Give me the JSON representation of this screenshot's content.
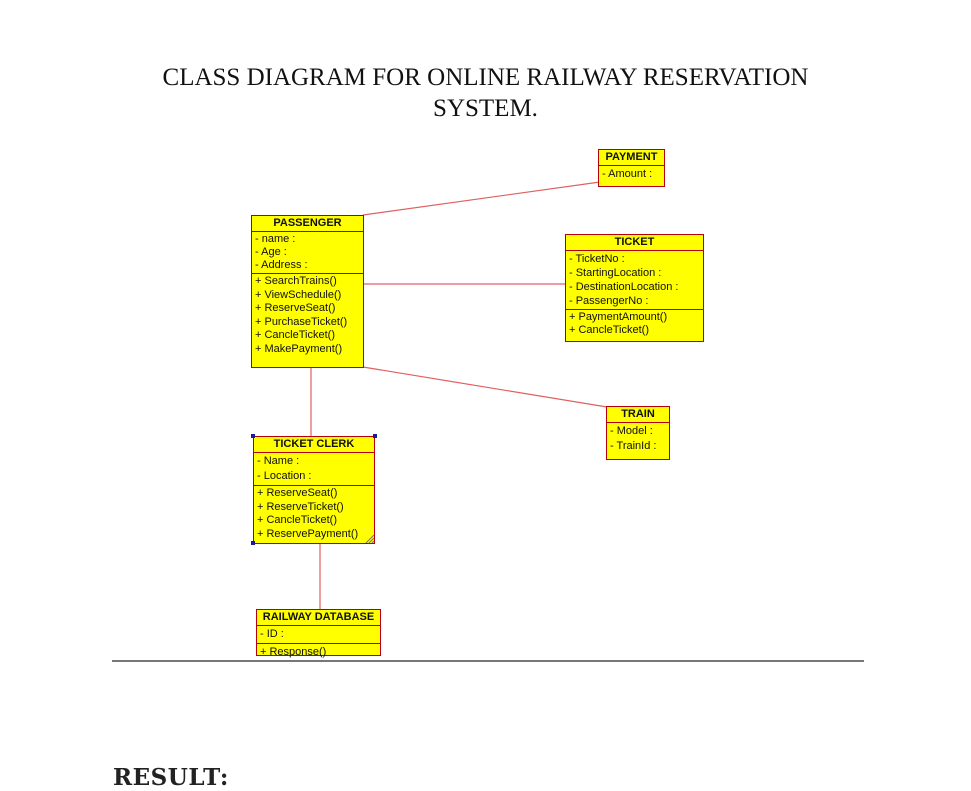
{
  "title_line1": "CLASS DIAGRAM FOR ONLINE RAILWAY RESERVATION",
  "title_line2": "SYSTEM.",
  "classes": {
    "payment": {
      "name": "PAYMENT",
      "attributes": [
        "- Amount :"
      ],
      "operations": []
    },
    "passenger": {
      "name": "PASSENGER",
      "attributes": [
        "- name :",
        "- Age :",
        "- Address :"
      ],
      "operations": [
        "+ SearchTrains()",
        "+ ViewSchedule()",
        "+ ReserveSeat()",
        "+ PurchaseTicket()",
        "+ CancleTicket()",
        "+ MakePayment()"
      ]
    },
    "ticket": {
      "name": "TICKET",
      "attributes": [
        "- TicketNo :",
        "- StartingLocation :",
        "- DestinationLocation :",
        "- PassengerNo :"
      ],
      "operations": [
        "+ PaymentAmount()",
        "+ CancleTicket()"
      ]
    },
    "train": {
      "name": "TRAIN",
      "attributes": [
        "- Model :",
        "- TrainId :"
      ],
      "operations": []
    },
    "ticket_clerk": {
      "name": "TICKET CLERK",
      "attributes": [
        "- Name :",
        "- Location :"
      ],
      "operations": [
        "+ ReserveSeat()",
        "+ ReserveTicket()",
        "+ CancleTicket()",
        "+ ReservePayment()"
      ]
    },
    "railway_database": {
      "name": "RAILWAY DATABASE",
      "attributes": [
        "- ID :"
      ],
      "operations": [
        "+ Response()"
      ]
    }
  },
  "result_heading": "RESULT:",
  "colors": {
    "class_fill": "#ffff00",
    "class_border": "#b8000b",
    "connector": "#e06060"
  }
}
